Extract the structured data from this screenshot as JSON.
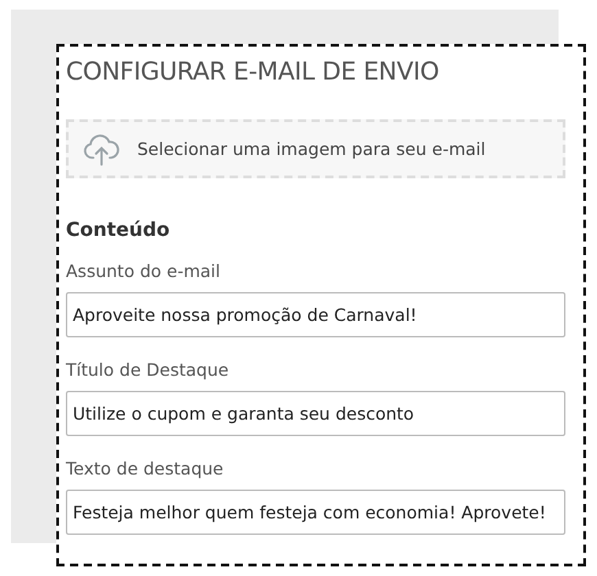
{
  "title": "CONFIGURAR E-MAIL DE ENVIO",
  "upload": {
    "label": "Selecionar uma imagem para seu e-mail"
  },
  "section": "Conteúdo",
  "fields": [
    {
      "label": "Assunto do e-mail",
      "value": "Aproveite nossa promoção de Carnaval!"
    },
    {
      "label": "Título de Destaque",
      "value": "Utilize o cupom e garanta seu desconto"
    },
    {
      "label": "Texto de destaque",
      "value": "Festeja melhor quem festeja com economia! Aprovete!"
    }
  ]
}
